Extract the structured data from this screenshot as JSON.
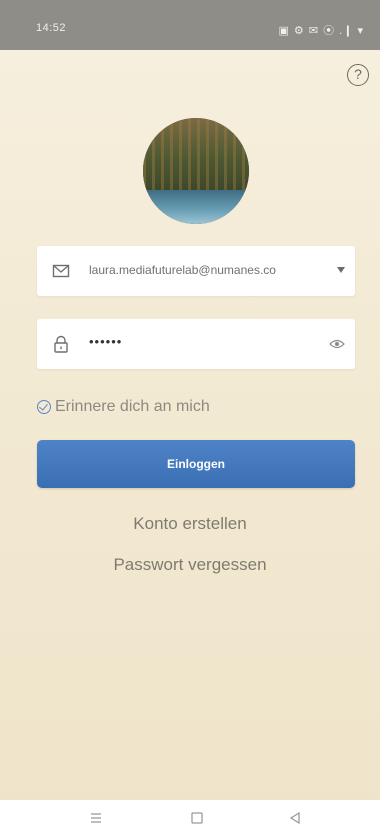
{
  "status_bar": {
    "time": "14:52",
    "icons_text": "▣ ⚙ ✉ ⦿ .❙ ▾",
    "icons": [
      "notification-icon",
      "settings-icon",
      "mail-icon",
      "wifi-icon",
      "signal-icon",
      "battery-icon"
    ]
  },
  "help": {
    "glyph": "?"
  },
  "login": {
    "email_value": "laura.mediafuturelab@numanes.co",
    "password_value": "••••••",
    "remember_label": "Erinnere dich an mich",
    "remember_checked": true,
    "login_label": "Einloggen",
    "create_account": "Konto erstellen",
    "forgot_password": "Passwort vergessen"
  },
  "colors": {
    "accent": "#3f72b8",
    "background": "#f5edda",
    "status_bar": "#8f8d88"
  },
  "nav": {
    "items": [
      "menu-icon",
      "home-square-icon",
      "back-triangle-icon"
    ]
  }
}
